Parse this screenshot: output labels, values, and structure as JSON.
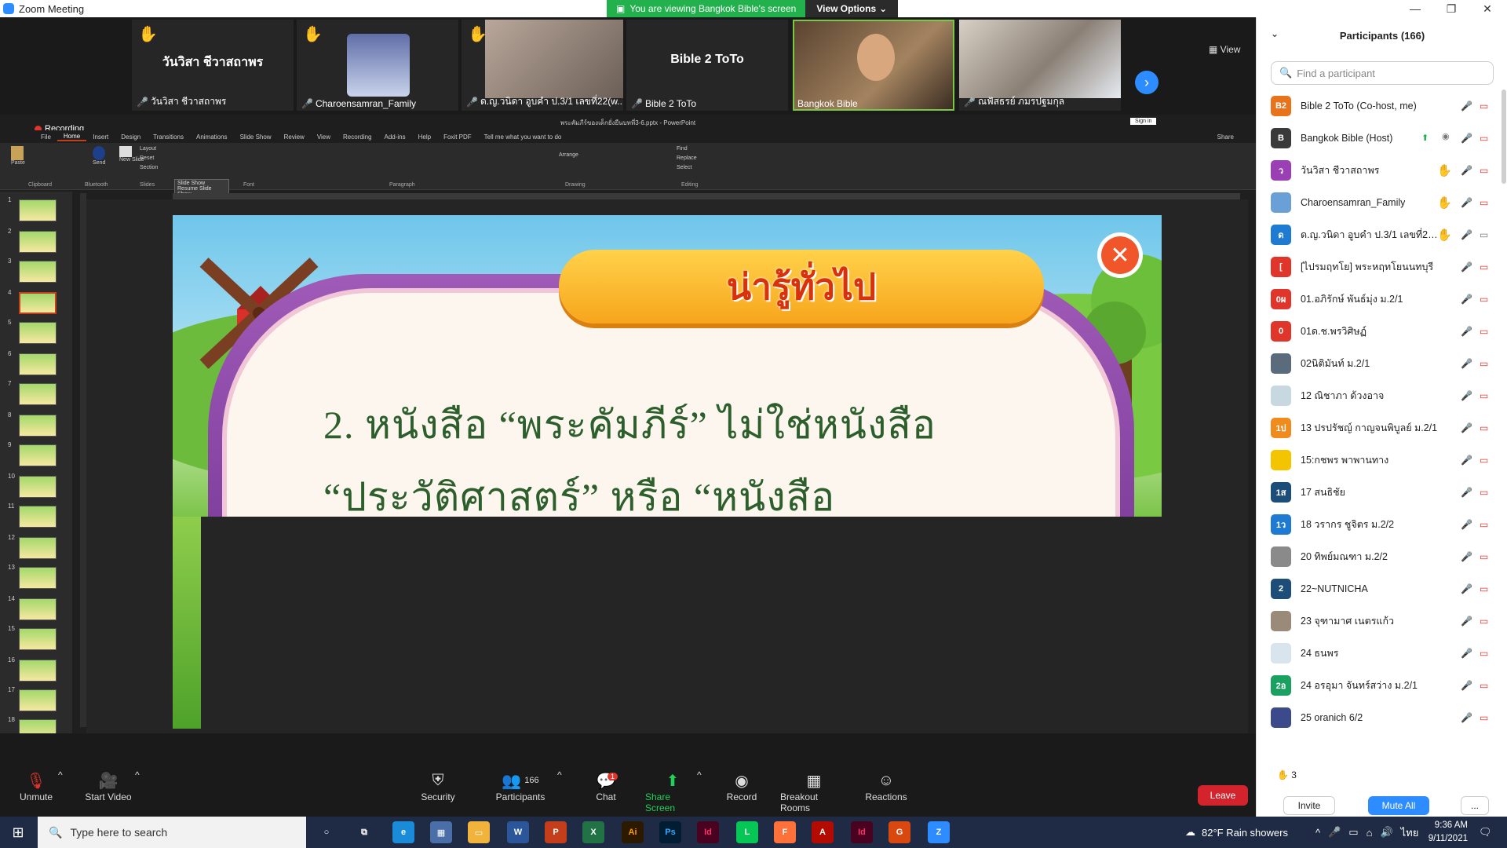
{
  "window": {
    "title": "Zoom Meeting",
    "banner_text": "You are viewing Bangkok Bible's screen",
    "view_options": "View Options",
    "view_button": "View"
  },
  "video_tiles": [
    {
      "label": "วันวิสา ชีวาสถาพร",
      "big": "วันวิสา ชีวาสถาพร",
      "hand": true
    },
    {
      "label": "Charoensamran_Family",
      "big": "",
      "hand": true
    },
    {
      "label": "ด.ญ.วนิดา อูบคำ ป.3/1 เลขที่22(w...",
      "big": "",
      "hand": true
    },
    {
      "label": "Bible 2 ToTo",
      "big": "Bible 2 ToTo",
      "hand": false
    },
    {
      "label": "Bangkok Bible",
      "big": "",
      "hand": false
    },
    {
      "label": "ณฟัสธรย์ ภมรปฐมกุล",
      "big": "",
      "hand": false
    }
  ],
  "powerpoint": {
    "recording": "Recording",
    "doc_title": "พระคัมภีร์ของเด็กยั่งยืนบทที่3-6.pptx - PowerPoint",
    "tabs": [
      "File",
      "Home",
      "Insert",
      "Design",
      "Transitions",
      "Animations",
      "Slide Show",
      "Review",
      "View",
      "Recording",
      "Add-ins",
      "Help",
      "Foxit PDF",
      "Tell me what you want to do"
    ],
    "sign_in": "Sign in",
    "share": "Share",
    "groups": [
      "Clipboard",
      "Bluetooth",
      "Slides",
      "Font",
      "Paragraph",
      "Drawing",
      "Editing"
    ],
    "buttons": {
      "paste": "Paste",
      "send": "Send",
      "new_slide": "New Slide",
      "layout": "Layout",
      "reset": "Reset",
      "section": "Section",
      "arrange": "Arrange",
      "find": "Find",
      "replace": "Replace",
      "select": "Select"
    },
    "popup": {
      "title": "Slide Show",
      "resume": "Resume Slide Show"
    },
    "slide_numbers": [
      "1",
      "2",
      "3",
      "4",
      "5",
      "6",
      "7",
      "8",
      "9",
      "10",
      "11",
      "12",
      "13",
      "14",
      "15",
      "16",
      "17",
      "18"
    ]
  },
  "slide": {
    "banner": "น่ารู้ทั่วไป",
    "line1": "2.   หนังสือ “พระคัมภีร์” ไม่ใช่หนังสือ",
    "line2": "“ประวัติศาสตร์” หรือ “หนังสือ"
  },
  "participants_panel": {
    "title": "Participants (166)",
    "search_placeholder": "Find a participant",
    "participants": [
      {
        "initials": "B2",
        "color": "#e8731d",
        "name": "Bible 2 ToTo (Co-host, me)",
        "hand": false,
        "extra": ""
      },
      {
        "initials": "B",
        "color": "#3a3a3a",
        "name": "Bangkok Bible (Host)",
        "hand": false,
        "extra": "host"
      },
      {
        "initials": "ว",
        "color": "#9b3fb5",
        "name": "วันวิสา ชีวาสถาพร",
        "hand": true,
        "extra": ""
      },
      {
        "initials": "",
        "color": "#6aa0d8",
        "name": "Charoensamran_Family",
        "hand": true,
        "extra": ""
      },
      {
        "initials": "ด",
        "color": "#1f7ad1",
        "name": "ด.ญ.วนิดา อูบคำ ป.3/1 เลขที่22...",
        "hand": true,
        "extra": "cam"
      },
      {
        "initials": "[",
        "color": "#e0352b",
        "name": "[ไปรมฤทโย] พระหฤทโยนนทบุรี",
        "hand": false,
        "extra": ""
      },
      {
        "initials": "0ผ",
        "color": "#e0352b",
        "name": "01.อภิรักษ์ พันธ์มุ่ง ม.2/1",
        "hand": false,
        "extra": ""
      },
      {
        "initials": "0",
        "color": "#e0352b",
        "name": "01ด.ช.พรวิศิษฏ์",
        "hand": false,
        "extra": ""
      },
      {
        "initials": "",
        "color": "#5a6b7c",
        "name": "02นิติมันท์ ม.2/1",
        "hand": false,
        "extra": ""
      },
      {
        "initials": "",
        "color": "#c8d8e0",
        "name": "12 ณิชาภา ด้วงอาจ",
        "hand": false,
        "extra": ""
      },
      {
        "initials": "1ป",
        "color": "#f08c1e",
        "name": "13 ปรปรัชญ์ กาญจนพิบูลย์ ม.2/1",
        "hand": false,
        "extra": ""
      },
      {
        "initials": "",
        "color": "#f5c400",
        "name": "15:กชพร พาพานทาง",
        "hand": false,
        "extra": ""
      },
      {
        "initials": "1ส",
        "color": "#1d4e7a",
        "name": "17 สนธิชัย",
        "hand": false,
        "extra": ""
      },
      {
        "initials": "1ว",
        "color": "#1f7ad1",
        "name": "18 วรากร ชูจิตร ม.2/2",
        "hand": false,
        "extra": ""
      },
      {
        "initials": "",
        "color": "#8a8a8a",
        "name": "20 ทิพย์มณฑา ม.2/2",
        "hand": false,
        "extra": ""
      },
      {
        "initials": "2",
        "color": "#1d4e7a",
        "name": "22~NUTNICHA",
        "hand": false,
        "extra": ""
      },
      {
        "initials": "",
        "color": "#9a8a7a",
        "name": "23 จุฑามาศ เนตรแก้ว",
        "hand": false,
        "extra": ""
      },
      {
        "initials": "",
        "color": "#d8e4ee",
        "name": "24 ธนพร",
        "hand": false,
        "extra": ""
      },
      {
        "initials": "2อ",
        "color": "#1aa061",
        "name": "24 อรอุมา จันทร์สว่าง ม.2/1",
        "hand": false,
        "extra": ""
      },
      {
        "initials": "",
        "color": "#3b4a8a",
        "name": "25 oranich 6/2",
        "hand": false,
        "extra": ""
      }
    ],
    "hands_count": "3",
    "invite": "Invite",
    "mute_all": "Mute All",
    "more": "..."
  },
  "toolbar": {
    "unmute": "Unmute",
    "start_video": "Start Video",
    "security": "Security",
    "participants": "Participants",
    "participants_count": "166",
    "chat": "Chat",
    "chat_badge": "1",
    "share_screen": "Share Screen",
    "record": "Record",
    "breakout_rooms": "Breakout Rooms",
    "reactions": "Reactions",
    "leave": "Leave"
  },
  "taskbar": {
    "search_placeholder": "Type here to search",
    "weather": "82°F  Rain showers",
    "lang": "ไทย",
    "time": "9:36 AM",
    "date": "9/11/2021",
    "apps": [
      "Cortana",
      "Task View",
      "Edge",
      "Calculator",
      "File Explorer",
      "Word",
      "PowerPoint",
      "Excel",
      "Illustrator",
      "Photoshop",
      "InDesign",
      "LINE",
      "Firefox",
      "Acrobat",
      "InDesign",
      "Grammarly",
      "Zoom"
    ]
  }
}
